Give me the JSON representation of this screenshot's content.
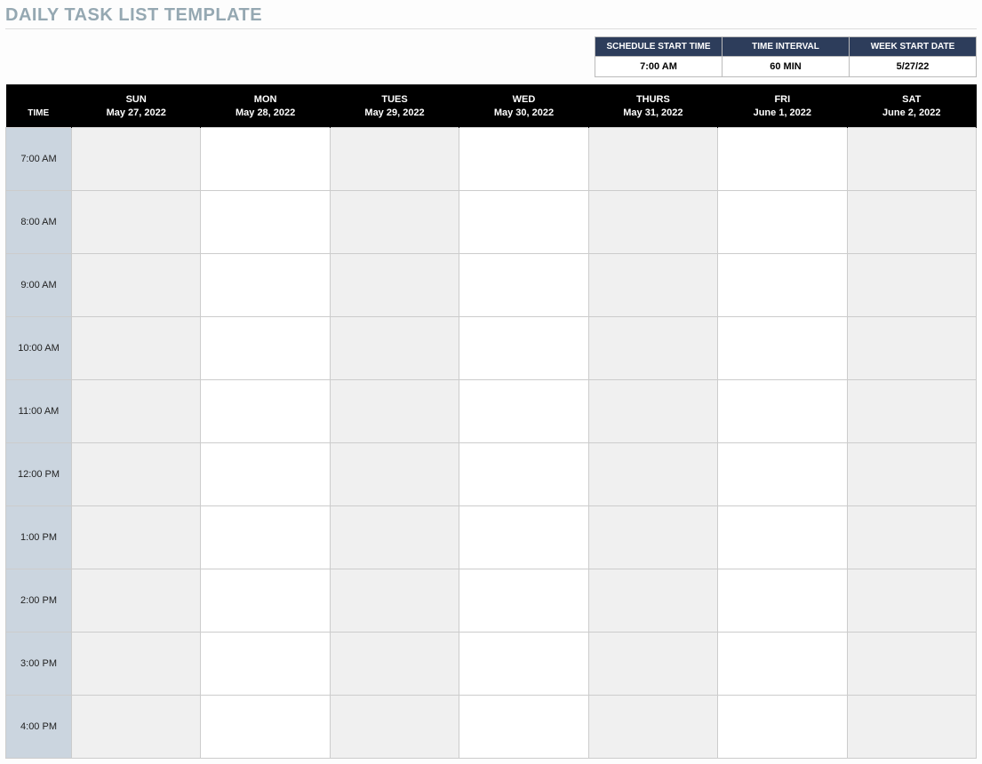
{
  "title": "DAILY TASK LIST TEMPLATE",
  "config": {
    "headers": [
      "SCHEDULE START TIME",
      "TIME INTERVAL",
      "WEEK START DATE"
    ],
    "values": [
      "7:00 AM",
      "60 MIN",
      "5/27/22"
    ]
  },
  "schedule": {
    "time_label": "TIME",
    "days": [
      {
        "name": "SUN",
        "date": "May 27, 2022"
      },
      {
        "name": "MON",
        "date": "May 28, 2022"
      },
      {
        "name": "TUES",
        "date": "May 29, 2022"
      },
      {
        "name": "WED",
        "date": "May 30, 2022"
      },
      {
        "name": "THURS",
        "date": "May 31, 2022"
      },
      {
        "name": "FRI",
        "date": "June 1, 2022"
      },
      {
        "name": "SAT",
        "date": "June 2, 2022"
      }
    ],
    "times": [
      "7:00 AM",
      "8:00 AM",
      "9:00 AM",
      "10:00 AM",
      "11:00 AM",
      "12:00 PM",
      "1:00 PM",
      "2:00 PM",
      "3:00 PM",
      "4:00 PM"
    ],
    "alt_columns": [
      1,
      3,
      5
    ]
  }
}
